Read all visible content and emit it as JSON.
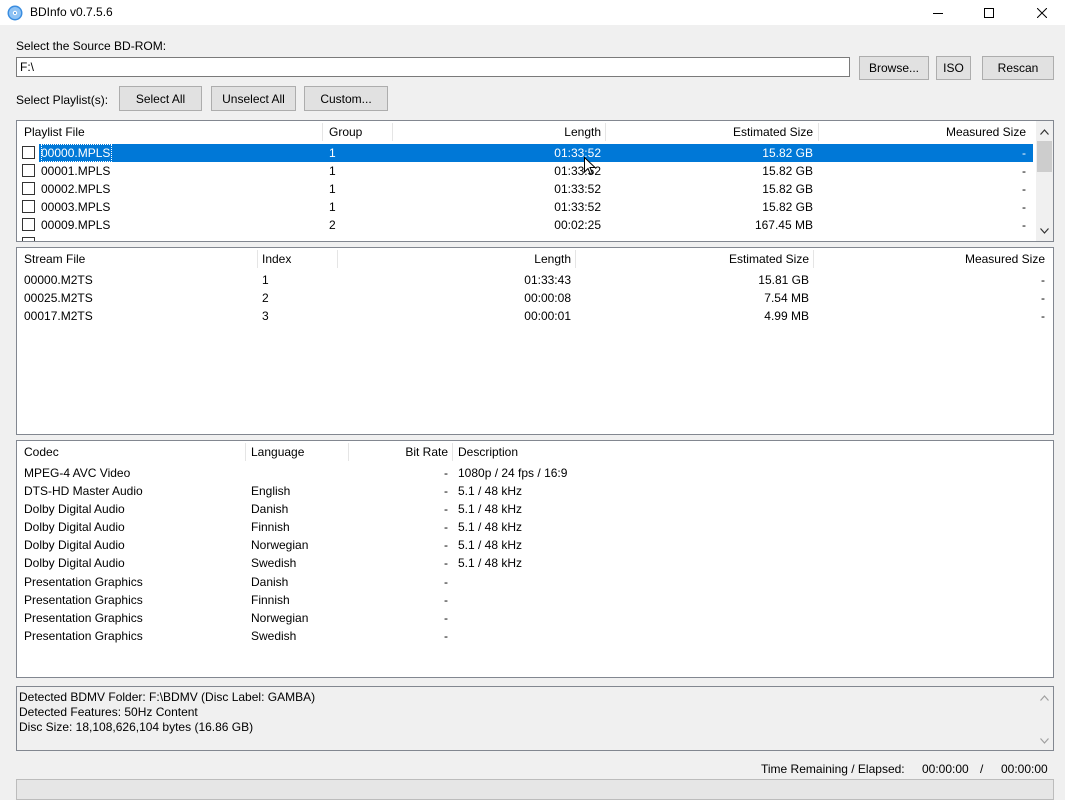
{
  "window": {
    "title": "BDInfo v0.7.5.6"
  },
  "source": {
    "label": "Select the Source BD-ROM:",
    "path_value": "F:\\",
    "browse_label": "Browse...",
    "iso_label": "ISO",
    "rescan_label": "Rescan"
  },
  "playlist_select": {
    "label": "Select Playlist(s):",
    "select_all_label": "Select All",
    "unselect_all_label": "Unselect All",
    "custom_label": "Custom..."
  },
  "playlists": {
    "headers": {
      "file": "Playlist File",
      "group": "Group",
      "length": "Length",
      "est": "Estimated Size",
      "meas": "Measured Size"
    },
    "rows": [
      {
        "file": "00000.MPLS",
        "group": "1",
        "length": "01:33:52",
        "est": "15.82 GB",
        "meas": "-",
        "selected": true
      },
      {
        "file": "00001.MPLS",
        "group": "1",
        "length": "01:33:52",
        "est": "15.82 GB",
        "meas": "-"
      },
      {
        "file": "00002.MPLS",
        "group": "1",
        "length": "01:33:52",
        "est": "15.82 GB",
        "meas": "-"
      },
      {
        "file": "00003.MPLS",
        "group": "1",
        "length": "01:33:52",
        "est": "15.82 GB",
        "meas": "-"
      },
      {
        "file": "00009.MPLS",
        "group": "2",
        "length": "00:02:25",
        "est": "167.45 MB",
        "meas": "-"
      }
    ]
  },
  "streams": {
    "headers": {
      "file": "Stream File",
      "index": "Index",
      "length": "Length",
      "est": "Estimated Size",
      "meas": "Measured Size"
    },
    "rows": [
      {
        "file": "00000.M2TS",
        "index": "1",
        "length": "01:33:43",
        "est": "15.81 GB",
        "meas": "-"
      },
      {
        "file": "00025.M2TS",
        "index": "2",
        "length": "00:00:08",
        "est": "7.54 MB",
        "meas": "-"
      },
      {
        "file": "00017.M2TS",
        "index": "3",
        "length": "00:00:01",
        "est": "4.99 MB",
        "meas": "-"
      }
    ]
  },
  "codecs": {
    "headers": {
      "codec": "Codec",
      "language": "Language",
      "bitrate": "Bit Rate",
      "description": "Description"
    },
    "rows": [
      {
        "codec": "MPEG-4 AVC Video",
        "language": "",
        "bitrate": "-",
        "description": "1080p / 24 fps / 16:9"
      },
      {
        "codec": "DTS-HD Master Audio",
        "language": "English",
        "bitrate": "-",
        "description": "5.1 / 48 kHz"
      },
      {
        "codec": "Dolby Digital Audio",
        "language": "Danish",
        "bitrate": "-",
        "description": "5.1 / 48 kHz"
      },
      {
        "codec": "Dolby Digital Audio",
        "language": "Finnish",
        "bitrate": "-",
        "description": "5.1 / 48 kHz"
      },
      {
        "codec": "Dolby Digital Audio",
        "language": "Norwegian",
        "bitrate": "-",
        "description": "5.1 / 48 kHz"
      },
      {
        "codec": "Dolby Digital Audio",
        "language": "Swedish",
        "bitrate": "-",
        "description": "5.1 / 48 kHz"
      },
      {
        "codec": "Presentation Graphics",
        "language": "Danish",
        "bitrate": "-",
        "description": ""
      },
      {
        "codec": "Presentation Graphics",
        "language": "Finnish",
        "bitrate": "-",
        "description": ""
      },
      {
        "codec": "Presentation Graphics",
        "language": "Norwegian",
        "bitrate": "-",
        "description": ""
      },
      {
        "codec": "Presentation Graphics",
        "language": "Swedish",
        "bitrate": "-",
        "description": ""
      }
    ]
  },
  "status": {
    "lines": [
      "Detected BDMV Folder: F:\\BDMV (Disc Label: GAMBA)",
      "Detected Features: 50Hz Content",
      "Disc Size: 18,108,626,104 bytes (16.86 GB)"
    ]
  },
  "time": {
    "label": "Time Remaining / Elapsed:",
    "remaining": "00:00:00",
    "divider": "/",
    "elapsed": "00:00:00"
  },
  "colors": {
    "selection": "#0078d7",
    "window_bg": "#f0f0f0",
    "panel_border": "#828790"
  },
  "icons": {
    "app": "disc-icon",
    "minimize": "minimize-icon",
    "maximize": "maximize-icon",
    "close": "close-icon"
  }
}
